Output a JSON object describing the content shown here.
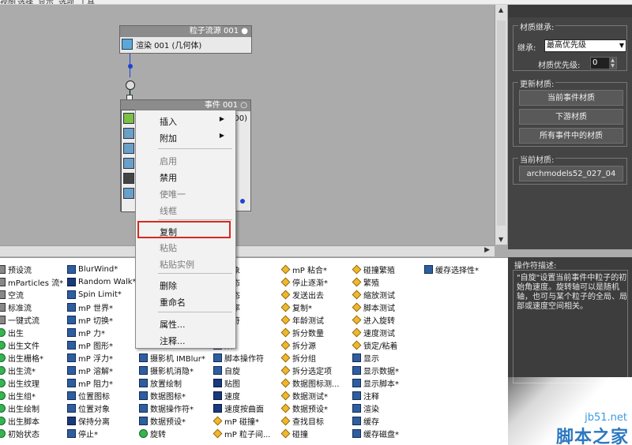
{
  "menubar": [
    "视图",
    "选择",
    "显示",
    "选项",
    "工具"
  ],
  "canvas": {
    "node1": {
      "title": "粒子流源 001",
      "row": "渲染 001 (几何体)"
    },
    "node2": {
      "title": "事件 001",
      "row_partial": "00)"
    }
  },
  "context_menu": {
    "items": [
      {
        "label": "插入",
        "submenu": true,
        "disabled": false
      },
      {
        "label": "附加",
        "submenu": true,
        "disabled": false
      },
      {
        "label": "启用",
        "disabled": true
      },
      {
        "label": "禁用",
        "disabled": false
      },
      {
        "label": "使唯一",
        "disabled": true
      },
      {
        "label": "线框",
        "disabled": true
      },
      {
        "label": "复制",
        "disabled": false,
        "highlighted": true
      },
      {
        "label": "粘贴",
        "disabled": true
      },
      {
        "label": "粘贴实例",
        "disabled": true
      },
      {
        "label": "删除",
        "disabled": false
      },
      {
        "label": "重命名",
        "disabled": false
      },
      {
        "label": "属性...",
        "disabled": false
      },
      {
        "label": "注释...",
        "disabled": false
      }
    ],
    "highlight_color": "#d52a1f"
  },
  "right_panel": {
    "material_inherit": {
      "legend": "材质继承:",
      "inherit_label": "继承:",
      "inherit_value": "最高优先级",
      "priority_label": "材质优先级:",
      "priority_value": "0"
    },
    "update_material": {
      "legend": "更新材质:",
      "buttons": [
        "当前事件材质",
        "下游材质",
        "所有事件中的材质"
      ]
    },
    "current_material": {
      "legend": "当前材质:",
      "value": "archmodels52_027_04"
    }
  },
  "operator_desc": {
    "title": "操作符描述:",
    "text": "\"自旋\"设置当前事件中粒子的初始角速度。旋转轴可以是随机轴，也可与某个粒子的全局、局部或速度空间相关。"
  },
  "list_columns": [
    [
      {
        "icon": "gy",
        "label": "预设流"
      },
      {
        "icon": "gy",
        "label": "mParticles 流*"
      },
      {
        "icon": "gy",
        "label": "空流"
      },
      {
        "icon": "gy",
        "label": "标准流"
      },
      {
        "icon": "gy",
        "label": "一键式流"
      },
      {
        "icon": "gr",
        "label": "出生"
      },
      {
        "icon": "gr",
        "label": "出生文件"
      },
      {
        "icon": "gr",
        "label": "出生栅格*"
      },
      {
        "icon": "gr",
        "label": "出生流*"
      },
      {
        "icon": "gr",
        "label": "出生纹理"
      },
      {
        "icon": "gr",
        "label": "出生组*"
      },
      {
        "icon": "gr",
        "label": "出生绘制"
      },
      {
        "icon": "gr",
        "label": "出生脚本"
      },
      {
        "icon": "gr",
        "label": "初始状态"
      }
    ],
    [
      {
        "icon": "bl",
        "label": "BlurWind*"
      },
      {
        "icon": "nv",
        "label": "Random Walk*"
      },
      {
        "icon": "bl",
        "label": "Spin Limit*"
      },
      {
        "icon": "bl",
        "label": "mP 世界*"
      },
      {
        "icon": "bl",
        "label": "mP 切换*"
      },
      {
        "icon": "bl",
        "label": "mP 力*"
      },
      {
        "icon": "bl",
        "label": "mP 图形*"
      },
      {
        "icon": "bl",
        "label": "mP 浮力*"
      },
      {
        "icon": "bl",
        "label": "mP 溶解*"
      },
      {
        "icon": "bl",
        "label": "mP 阻力*"
      },
      {
        "icon": "bl",
        "label": "位置图标"
      },
      {
        "icon": "bl",
        "label": "位置对象"
      },
      {
        "icon": "nv",
        "label": "保持分离"
      },
      {
        "icon": "bl",
        "label": "停止*"
      }
    ],
    [
      {
        "icon": "bl",
        "label": "摄影机 IMBlur*"
      },
      {
        "icon": "bl",
        "label": "摄影机消隐*"
      },
      {
        "icon": "bl",
        "label": "放置绘制"
      },
      {
        "icon": "bl",
        "label": "数据图标*"
      },
      {
        "icon": "bl",
        "label": "数据操作符*"
      },
      {
        "icon": "bl",
        "label": "数据预设*"
      },
      {
        "icon": "gr",
        "label": "旋转"
      }
    ],
    [
      {
        "icon": "bl",
        "label": "对象"
      },
      {
        "icon": "bl",
        "label": "动态"
      },
      {
        "icon": "bl",
        "label": "静态"
      },
      {
        "icon": "bl",
        "label": "频率"
      },
      {
        "icon": "bl",
        "label": "作符"
      },
      {
        "icon": "bl",
        "label": "择"
      },
      {
        "icon": "bl",
        "label": "数"
      },
      {
        "icon": "bl",
        "label": "脚本操作符"
      },
      {
        "icon": "bl",
        "label": "自旋"
      },
      {
        "icon": "nv",
        "label": "贴图"
      },
      {
        "icon": "nv",
        "label": "速度"
      },
      {
        "icon": "nv",
        "label": "速度按曲面"
      },
      {
        "icon": "gd",
        "label": "mP 碰撞*"
      },
      {
        "icon": "gd",
        "label": "mP 粒子间..."
      }
    ],
    [
      {
        "icon": "gd",
        "label": "mP 粘合*"
      },
      {
        "icon": "gd",
        "label": "停止逐渐*"
      },
      {
        "icon": "gd",
        "label": "发送出去"
      },
      {
        "icon": "gd",
        "label": "复制*"
      },
      {
        "icon": "gd",
        "label": "年龄测试"
      },
      {
        "icon": "gd",
        "label": "拆分数量"
      },
      {
        "icon": "gd",
        "label": "拆分源"
      },
      {
        "icon": "gd",
        "label": "拆分组"
      },
      {
        "icon": "gd",
        "label": "拆分选定项"
      },
      {
        "icon": "gd",
        "label": "数据图标测..."
      },
      {
        "icon": "gd",
        "label": "数据测试*"
      },
      {
        "icon": "gd",
        "label": "数据预设*"
      },
      {
        "icon": "gd",
        "label": "查找目标"
      },
      {
        "icon": "gd",
        "label": "碰撞"
      }
    ],
    [
      {
        "icon": "gd",
        "label": "碰撞繁殖"
      },
      {
        "icon": "gd",
        "label": "繁殖"
      },
      {
        "icon": "gd",
        "label": "缩放测试"
      },
      {
        "icon": "gd",
        "label": "脚本测试"
      },
      {
        "icon": "gd",
        "label": "进入旋转"
      },
      {
        "icon": "gd",
        "label": "速度测试"
      },
      {
        "icon": "gd",
        "label": "锁定/粘着"
      },
      {
        "icon": "bl",
        "label": "显示"
      },
      {
        "icon": "bl",
        "label": "显示数据*"
      },
      {
        "icon": "bl",
        "label": "显示脚本*"
      },
      {
        "icon": "bl",
        "label": "注释"
      },
      {
        "icon": "bl",
        "label": "渲染"
      },
      {
        "icon": "bl",
        "label": "缓存"
      },
      {
        "icon": "bl",
        "label": "缓存磁盘*"
      }
    ],
    [
      {
        "icon": "bl",
        "label": "缓存选择性*"
      }
    ]
  ],
  "watermark": {
    "line1": "jb51.net",
    "line2": "脚本之家"
  }
}
